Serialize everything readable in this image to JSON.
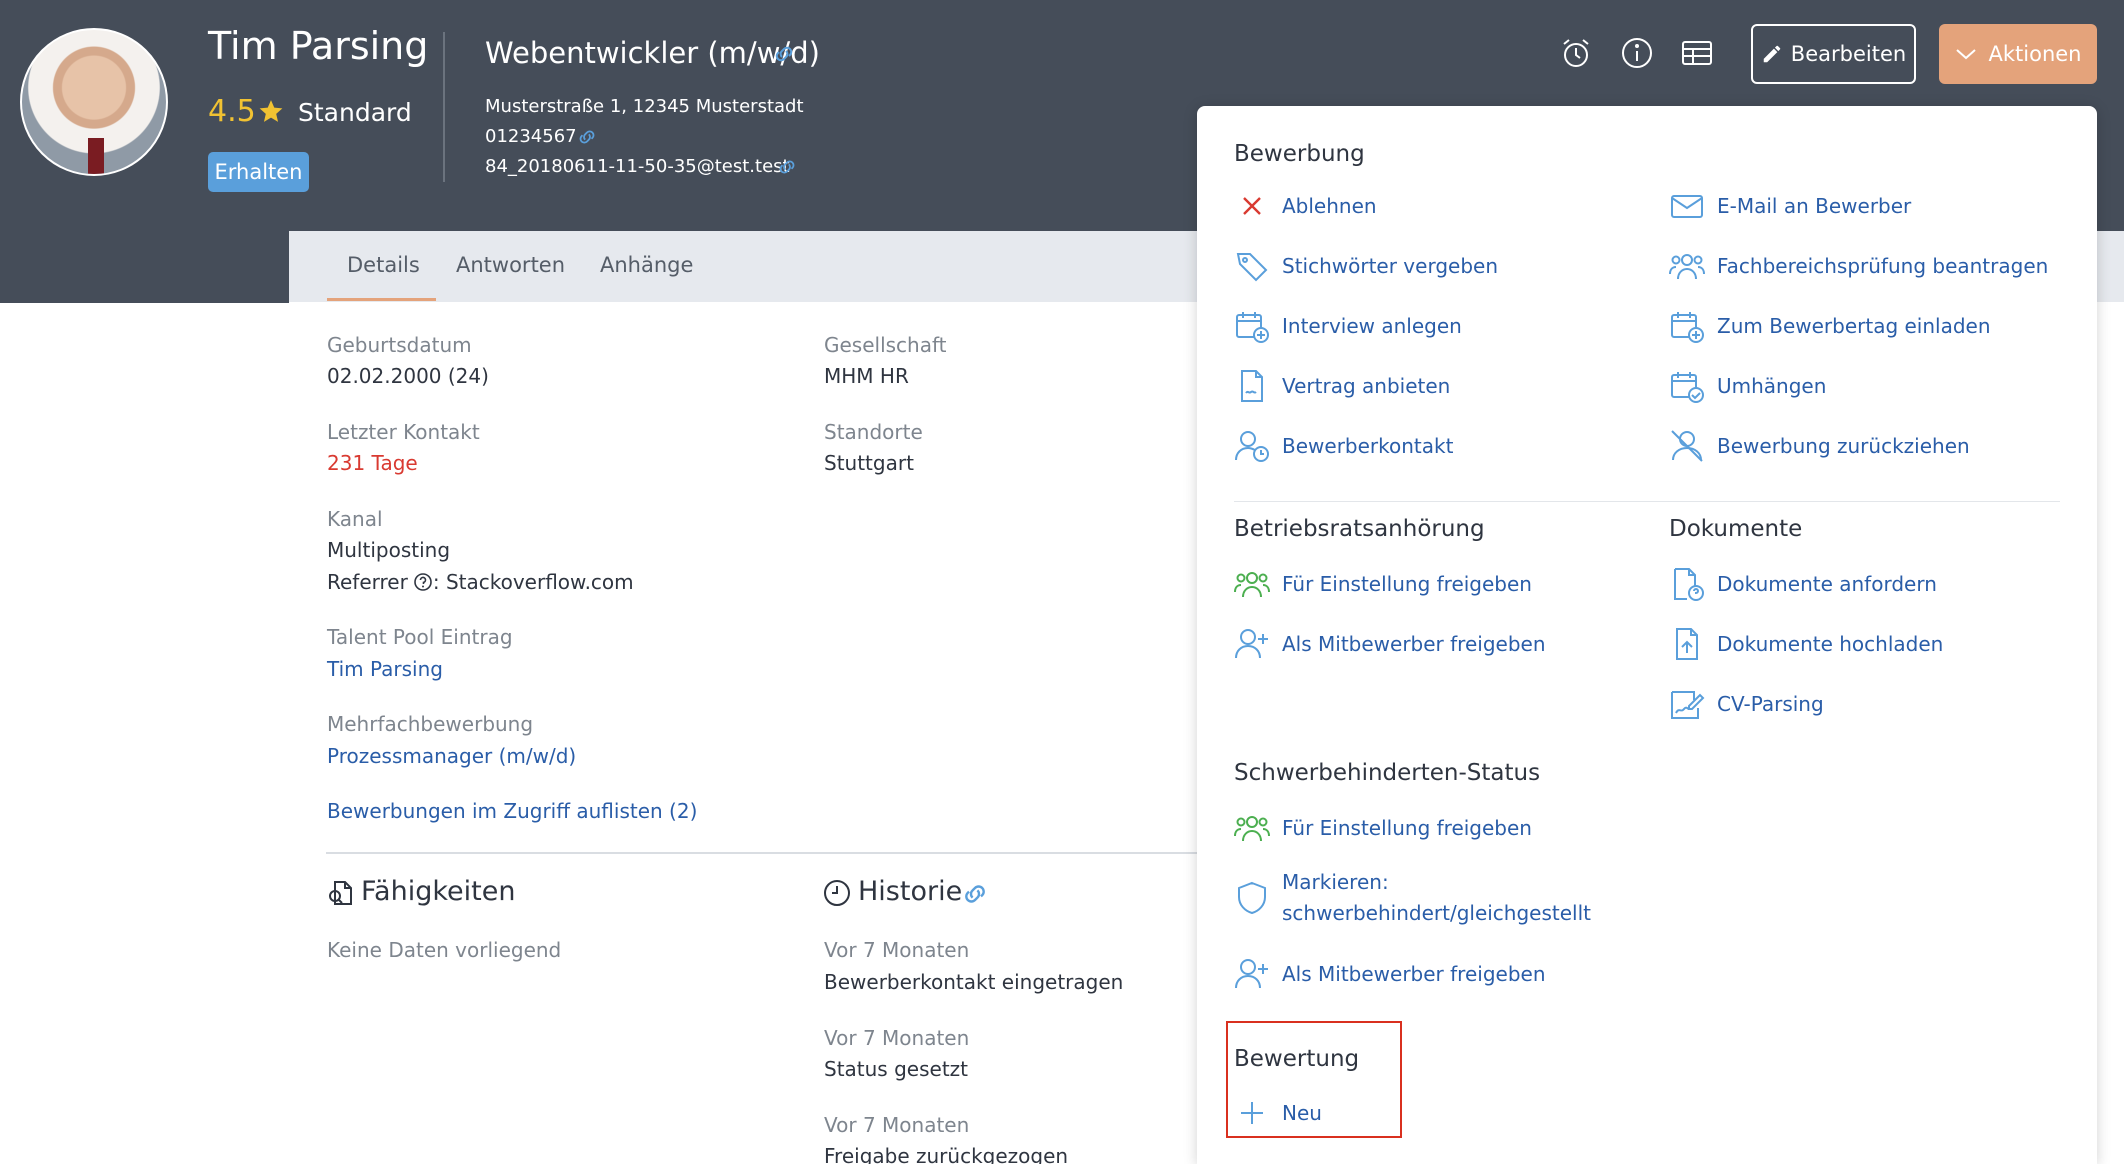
{
  "candidate": {
    "name": "Tim Parsing",
    "rating": "4.5",
    "level": "Standard",
    "status_badge": "Erhalten",
    "job_title": "Webentwickler (m/w/d)",
    "address": "Musterstraße 1, 12345 Musterstadt",
    "phone": "01234567",
    "email": "84_20180611-11-50-35@test.test"
  },
  "header_actions": {
    "edit_label": "Bearbeiten",
    "actions_label": "Aktionen",
    "icons": [
      "alarm-clock-icon",
      "info-icon",
      "table-icon"
    ]
  },
  "tabs": [
    {
      "label": "Details"
    },
    {
      "label": "Antworten"
    },
    {
      "label": "Anhänge"
    }
  ],
  "details": {
    "birthdate_label": "Geburtsdatum",
    "birthdate": "02.02.2000 (24)",
    "company_label": "Gesellschaft",
    "company": "MHM HR",
    "last_contact_label": "Letzter Kontakt",
    "last_contact": "231 Tage",
    "locations_label": "Standorte",
    "locations": "Stuttgart",
    "channel_label": "Kanal",
    "channel": "Multiposting",
    "referrer_label": "Referrer",
    "referrer": "Stackoverflow.com",
    "talentpool_label": "Talent Pool Eintrag",
    "talentpool": "Tim Parsing",
    "multi_label": "Mehrfachbewerbung",
    "multi": "Prozessmanager (m/w/d)",
    "list_link": "Bewerbungen im Zugriff auflisten (2)"
  },
  "skills": {
    "title": "Fähigkeiten",
    "empty": "Keine Daten vorliegend"
  },
  "history": {
    "title": "Historie",
    "entries": [
      {
        "time": "Vor 7 Monaten",
        "text": "Bewerberkontakt eingetragen"
      },
      {
        "time": "Vor 7 Monaten",
        "text": "Status gesetzt"
      },
      {
        "time": "Vor 7 Monaten",
        "text": "Freigabe zurückgezogen"
      }
    ]
  },
  "menu": {
    "bewerbung": {
      "heading": "Bewerbung",
      "left": [
        {
          "label": "Ablehnen",
          "icon": "close-icon"
        },
        {
          "label": "Stichwörter vergeben",
          "icon": "tag-icon"
        },
        {
          "label": "Interview anlegen",
          "icon": "calendar-plus-icon"
        },
        {
          "label": "Vertrag anbieten",
          "icon": "contract-icon"
        },
        {
          "label": "Bewerberkontakt",
          "icon": "user-clock-icon"
        }
      ],
      "right": [
        {
          "label": "E-Mail an Bewerber",
          "icon": "mail-icon"
        },
        {
          "label": "Fachbereichsprüfung beantragen",
          "icon": "users-icon"
        },
        {
          "label": "Zum Bewerbertag einladen",
          "icon": "calendar-plus-icon"
        },
        {
          "label": "Umhängen",
          "icon": "calendar-check-icon"
        },
        {
          "label": "Bewerbung zurückziehen",
          "icon": "user-slash-icon"
        }
      ]
    },
    "betriebsrat": {
      "heading": "Betriebsratsanhörung",
      "items": [
        {
          "label": "Für Einstellung freigeben",
          "icon": "users-green-icon"
        },
        {
          "label": "Als Mitbewerber freigeben",
          "icon": "user-plus-icon"
        }
      ]
    },
    "dokumente": {
      "heading": "Dokumente",
      "items": [
        {
          "label": "Dokumente anfordern",
          "icon": "document-question-icon"
        },
        {
          "label": "Dokumente hochladen",
          "icon": "document-upload-icon"
        },
        {
          "label": "CV-Parsing",
          "icon": "cv-parsing-icon"
        }
      ]
    },
    "schwerbehindert": {
      "heading": "Schwerbehinderten-Status",
      "items": [
        {
          "label": "Für Einstellung freigeben",
          "icon": "users-green-icon"
        },
        {
          "label": "Markieren: schwerbehindert/gleichgestellt",
          "icon": "shield-icon"
        },
        {
          "label": "Als Mitbewerber freigeben",
          "icon": "user-plus-icon"
        }
      ]
    },
    "bewertung": {
      "heading": "Bewertung",
      "items": [
        {
          "label": "Neu",
          "icon": "plus-icon"
        }
      ]
    }
  },
  "colors": {
    "header_bg": "#454d59",
    "accent": "#e4a37b",
    "link": "#2a5da8",
    "icon_blue": "#5a9fdb",
    "icon_green": "#4caf50",
    "warning_red": "#d93a31",
    "star_yellow": "#f1c232"
  }
}
